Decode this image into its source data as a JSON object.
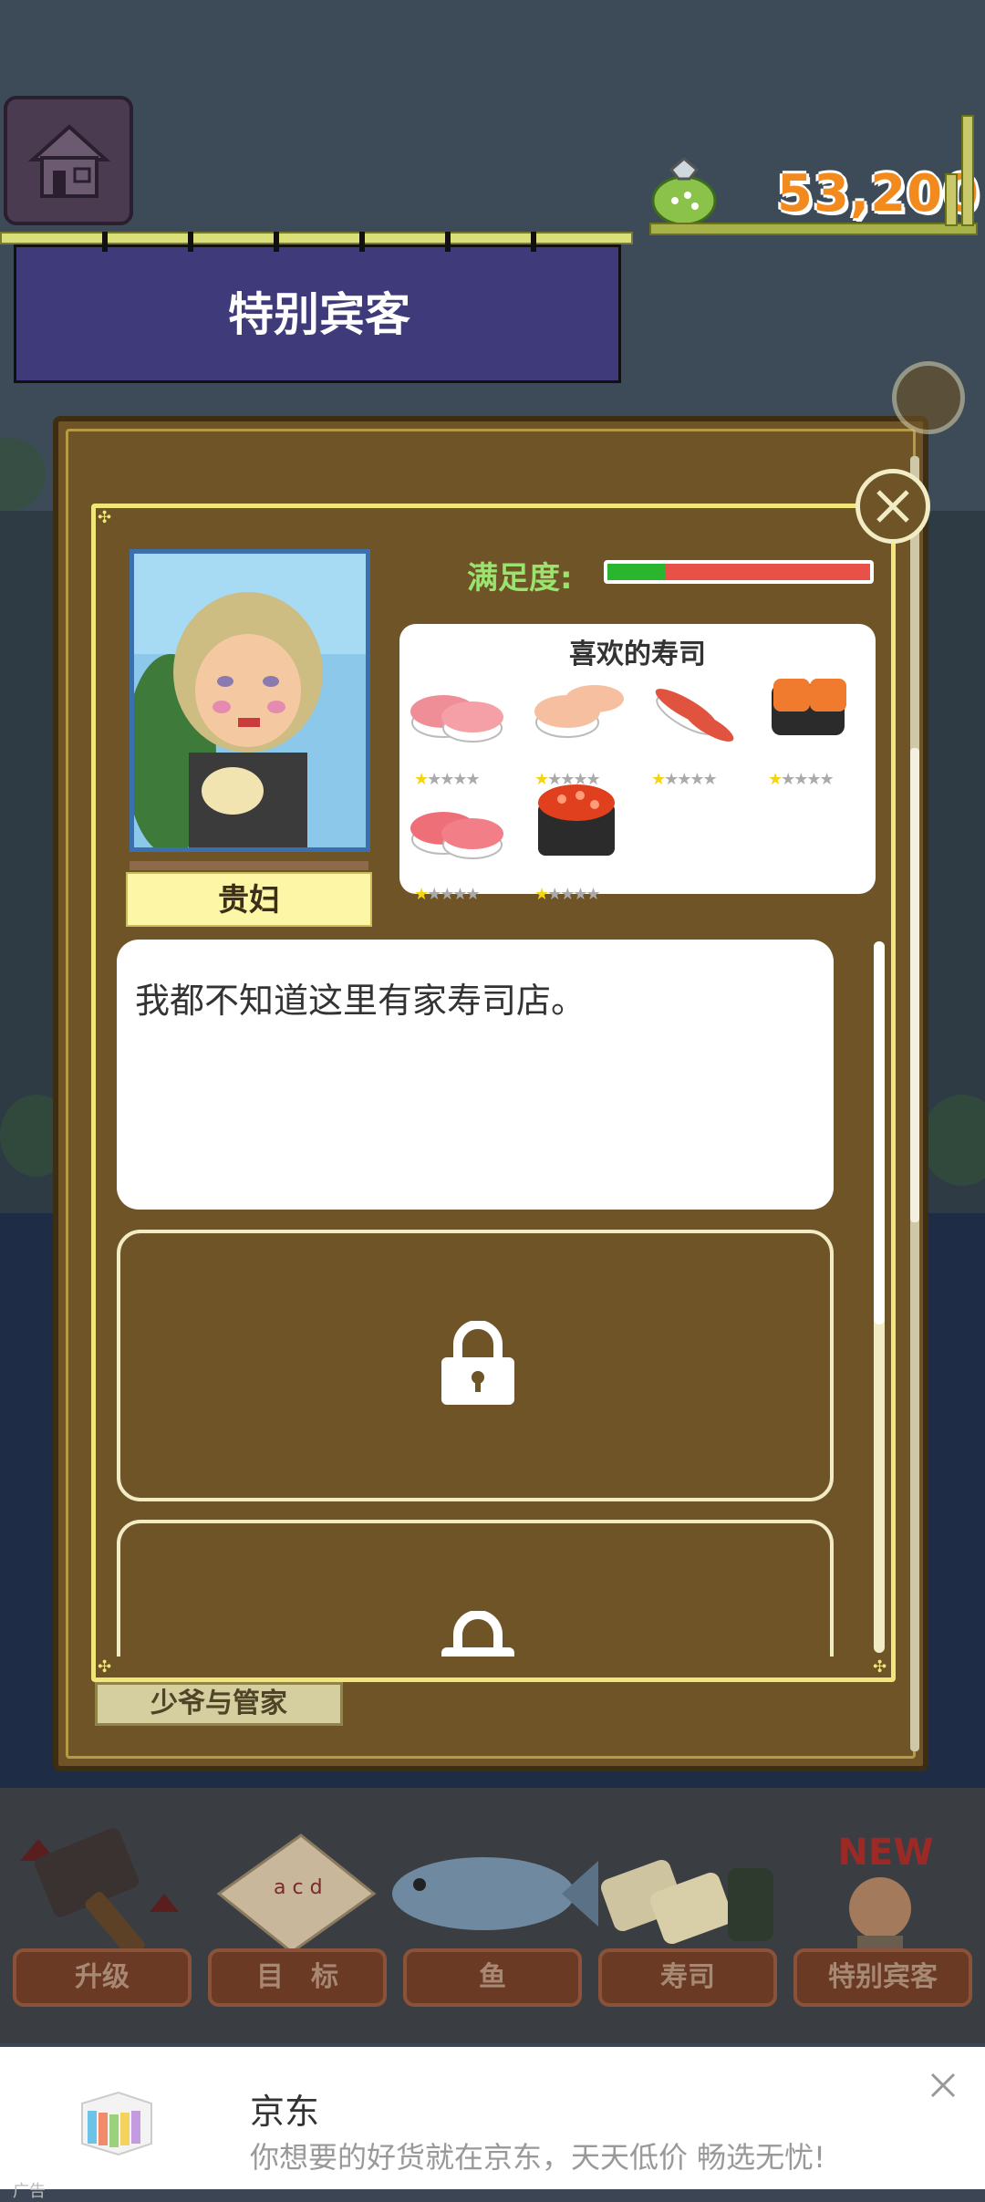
{
  "header": {
    "money": "53,200",
    "banner_title": "特别宾客"
  },
  "dialog": {
    "satisfaction_label": "满足度:",
    "satisfaction_level": 0.22,
    "customer_name": "贵妇",
    "favorite_title": "喜欢的寿司",
    "favorite_sushi": [
      {
        "name": "tuna-nigiri",
        "stars": 1
      },
      {
        "name": "salmon-nigiri",
        "stars": 1
      },
      {
        "name": "shrimp-nigiri",
        "stars": 1
      },
      {
        "name": "salmon-gunkan",
        "stars": 1
      },
      {
        "name": "fatty-tuna-nigiri",
        "stars": 1
      },
      {
        "name": "salmon-roe-gunkan",
        "stars": 1
      }
    ],
    "message": "我都不知道这里有家寿司店。",
    "next_guest_label": "少爷与管家"
  },
  "tabs": [
    {
      "label": "升级"
    },
    {
      "label": "目　标"
    },
    {
      "label": "鱼"
    },
    {
      "label": "寿司"
    },
    {
      "label": "特别宾客"
    }
  ],
  "new_badge": "NEW",
  "ad": {
    "title": "京东",
    "description": "你想要的好货就在京东，天天低价 畅选无忧!",
    "tag": "广告"
  },
  "colors": {
    "panel_brown": "#6e5427",
    "panel_border": "#f0e67a",
    "banner_blue": "#3f3b7a",
    "money_orange": "#f38a1d",
    "satisfaction_green": "#29b52d",
    "satisfaction_red": "#e85147"
  }
}
